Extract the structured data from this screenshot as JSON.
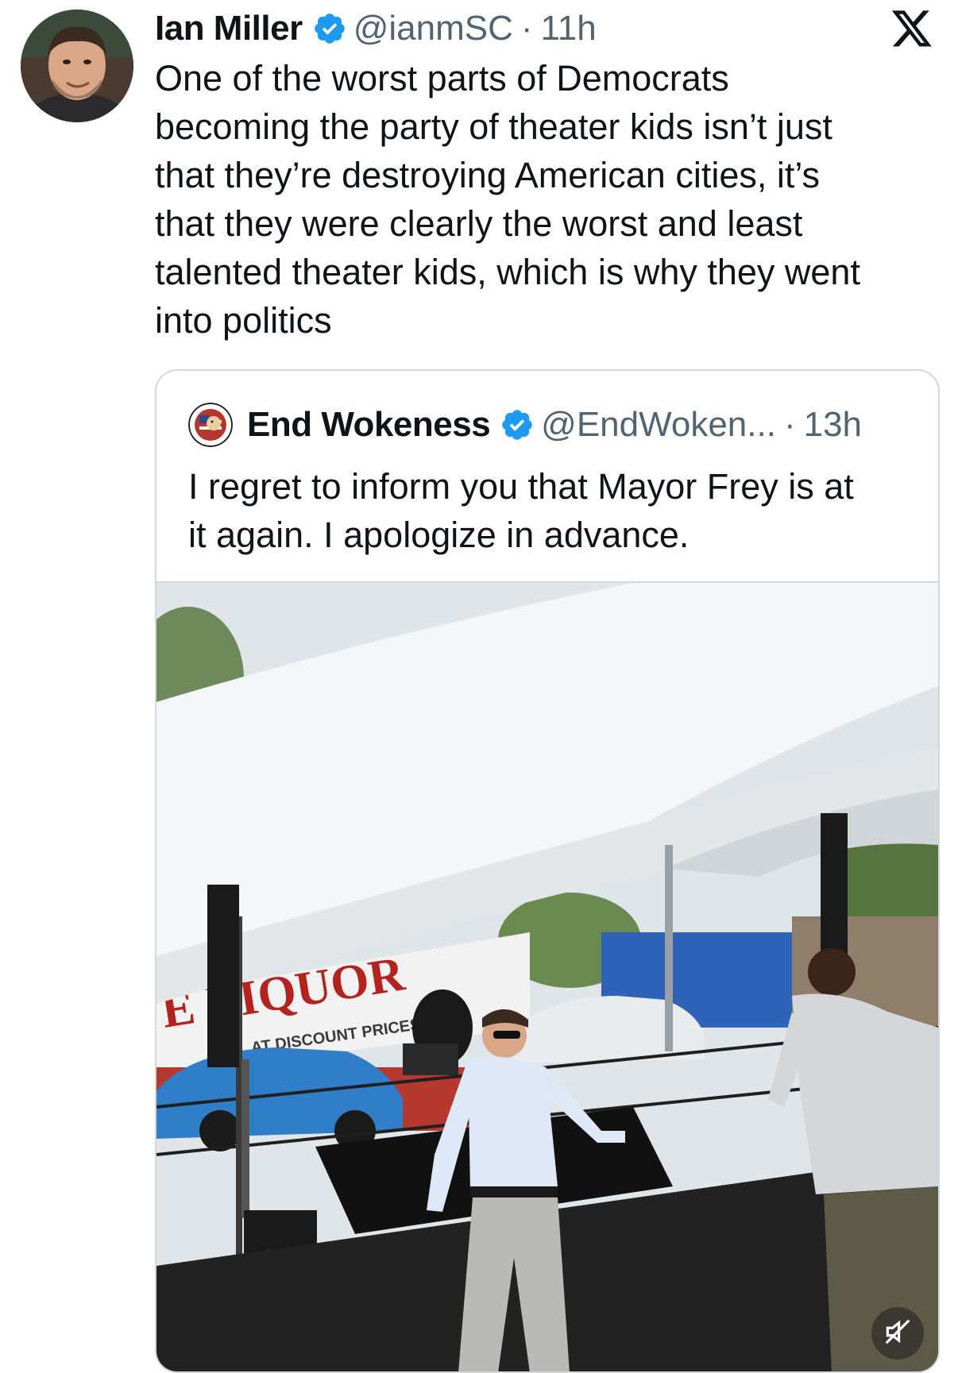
{
  "tweet": {
    "author_name": "Ian Miller",
    "author_handle": "@ianmSC",
    "separator": "·",
    "time": "11h",
    "text": "One of the worst parts of Democrats\nbecoming the party of theater kids isn’t just\nthat they’re destroying American cities, it’s\nthat they were clearly the worst and least\ntalented theater kids, which is why they went\ninto politics",
    "verified": true
  },
  "quoted_tweet": {
    "author_name": "End Wokeness",
    "author_handle": "@EndWoken...",
    "separator": "·",
    "time": "13h",
    "text": "I regret to inform you that Mayor Frey is at\nit again. I apologize in advance.",
    "verified": true,
    "media": {
      "type": "video",
      "sign_main": "E LIQUOR",
      "sign_sub": "AT DISCOUNT PRICES",
      "muted": true
    }
  },
  "icons": {
    "verified": "verified-badge-icon",
    "platform": "x-logo-icon",
    "mute": "muted-speaker-icon"
  },
  "colors": {
    "verified_blue": "#1d9bf0",
    "secondary_text": "#536471",
    "border": "#cfd9de"
  }
}
